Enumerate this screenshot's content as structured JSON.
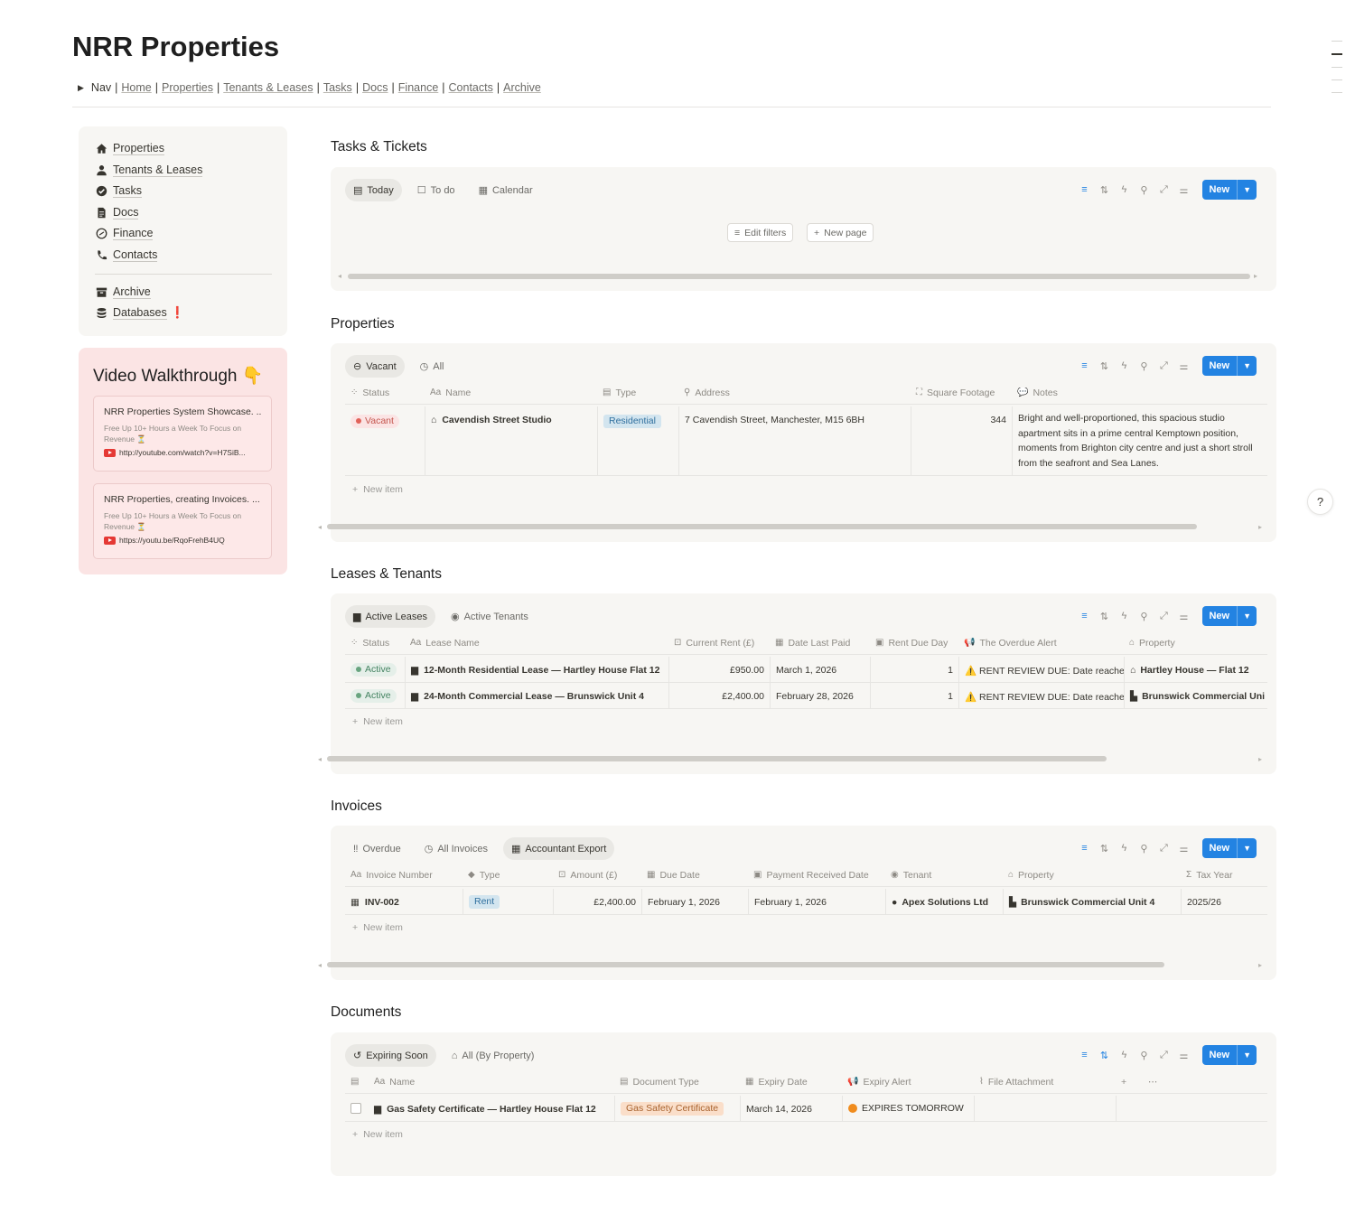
{
  "page": {
    "title": "NRR Properties"
  },
  "nav": {
    "toggle_label": "Nav",
    "links": [
      "Home",
      "Properties",
      "Tenants & Leases",
      "Tasks",
      "Docs",
      "Finance",
      "Contacts",
      "Archive"
    ]
  },
  "sidebar": {
    "items": [
      {
        "label": "Properties",
        "icon": "home-icon"
      },
      {
        "label": "Tenants & Leases",
        "icon": "person-icon"
      },
      {
        "label": "Tasks",
        "icon": "check-circle-icon"
      },
      {
        "label": "Docs",
        "icon": "document-icon"
      },
      {
        "label": "Finance",
        "icon": "coin-icon"
      },
      {
        "label": "Contacts",
        "icon": "phone-icon"
      }
    ],
    "items2": [
      {
        "label": "Archive",
        "icon": "archive-icon"
      },
      {
        "label": "Databases",
        "icon": "database-icon",
        "badge": "❗"
      }
    ]
  },
  "video": {
    "title": "Video Walkthrough 👇",
    "cards": [
      {
        "title": "NRR Properties System Showcase. ...",
        "desc": "Free Up 10+ Hours a Week To Focus on Revenue ⏳",
        "url": "http://youtube.com/watch?v=H7SiB..."
      },
      {
        "title": "NRR Properties, creating Invoices. ...",
        "desc": "Free Up 10+ Hours a Week To Focus on Revenue ⏳",
        "url": "https://youtu.be/RqoFrehB4UQ"
      }
    ]
  },
  "toolbar": {
    "new_label": "New"
  },
  "tasks": {
    "title": "Tasks & Tickets",
    "tabs": [
      "Today",
      "To do",
      "Calendar"
    ],
    "edit_filters": "Edit filters",
    "new_page": "New page"
  },
  "properties": {
    "title": "Properties",
    "tabs": [
      "Vacant",
      "All"
    ],
    "headers": [
      "Status",
      "Name",
      "Type",
      "Address",
      "Square Footage",
      "Notes"
    ],
    "rows": [
      {
        "status": "Vacant",
        "name": "Cavendish Street Studio",
        "type": "Residential",
        "address": "7 Cavendish Street, Manchester, M15 6BH",
        "sqft": "344",
        "notes": "Bright and well-proportioned, this spacious studio apartment sits in a prime central Kemptown position, moments from Brighton city centre and just a short stroll from the seafront and Sea Lanes."
      }
    ],
    "new_item": "New item"
  },
  "leases": {
    "title": "Leases & Tenants",
    "tabs": [
      "Active Leases",
      "Active Tenants"
    ],
    "headers": [
      "Status",
      "Lease Name",
      "Current Rent (£)",
      "Date Last Paid",
      "Rent Due Day",
      "The Overdue Alert",
      "Property"
    ],
    "rows": [
      {
        "status": "Active",
        "name": "12-Month Residential Lease — Hartley House Flat 12",
        "rent": "£950.00",
        "last_paid": "March 1, 2026",
        "due_day": "1",
        "alert": "⚠️ RENT REVIEW DUE: Date reached",
        "property": "Hartley House — Flat 12"
      },
      {
        "status": "Active",
        "name": "24-Month Commercial Lease — Brunswick Unit 4",
        "rent": "£2,400.00",
        "last_paid": "February 28, 2026",
        "due_day": "1",
        "alert": "⚠️ RENT REVIEW DUE: Date reached",
        "property": "Brunswick Commercial Uni"
      }
    ],
    "new_item": "New item"
  },
  "invoices": {
    "title": "Invoices",
    "tabs": [
      "Overdue",
      "All Invoices",
      "Accountant Export"
    ],
    "headers": [
      "Invoice Number",
      "Type",
      "Amount (£)",
      "Due Date",
      "Payment Received Date",
      "Tenant",
      "Property",
      "Tax Year"
    ],
    "rows": [
      {
        "number": "INV-002",
        "type": "Rent",
        "amount": "£2,400.00",
        "due": "February 1, 2026",
        "received": "February 1, 2026",
        "tenant": "Apex Solutions Ltd",
        "property": "Brunswick Commercial Unit 4",
        "tax_year": "2025/26"
      }
    ],
    "new_item": "New item"
  },
  "documents": {
    "title": "Documents",
    "tabs": [
      "Expiring Soon",
      "All (By Property)"
    ],
    "headers": [
      "Name",
      "Document Type",
      "Expiry Date",
      "Expiry Alert",
      "File Attachment"
    ],
    "rows": [
      {
        "name": "Gas Safety Certificate — Hartley House Flat 12",
        "doc_type": "Gas Safety Certificate",
        "expiry": "March 14, 2026",
        "alert": "EXPIRES TOMORROW"
      }
    ],
    "new_item": "New item"
  },
  "help": {
    "label": "?"
  },
  "colors": {
    "accent": "#2383e2",
    "panel": "#f7f6f3",
    "video_bg": "#fbe4e4"
  }
}
